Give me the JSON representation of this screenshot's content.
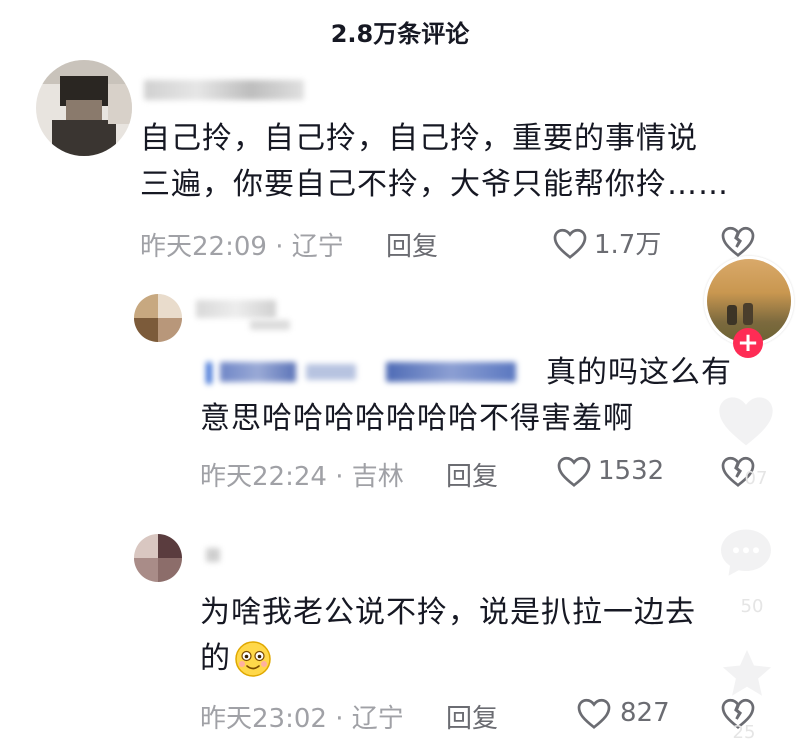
{
  "header": {
    "title": "2.8万条评论"
  },
  "comments": [
    {
      "text_line1": "自己拎，自己拎，自己拎，重要的事情说",
      "text_line2": "三遍，你要自己不拎，大爷只能帮你拎……",
      "time_location": "昨天22:09 · 辽宁",
      "reply_label": "回复",
      "likes": "1.7万"
    },
    {
      "text_line1": "真的吗这么有",
      "text_line2": "意思哈哈哈哈哈哈哈不得害羞啊",
      "time_location": "昨天22:24 · 吉林",
      "reply_label": "回复",
      "likes": "1532"
    },
    {
      "text_line1": "为啥我老公说不拎，说是扒拉一边去",
      "text_line2": "的",
      "time_location": "昨天23:02 · 辽宁",
      "reply_label": "回复",
      "likes": "827"
    }
  ],
  "side_panel": {
    "share_count": "25",
    "comment_count": "50",
    "like_count": "07"
  },
  "icons": {
    "like": "heart-outline-icon",
    "dislike": "broken-heart-icon",
    "emoji": "smile-emoji-icon",
    "follow": "plus-icon",
    "side_like": "heart-icon",
    "side_comment": "comment-bubble-icon",
    "side_favorite": "star-icon"
  },
  "colors": {
    "text_primary": "#161823",
    "text_meta": "#a0a1a6",
    "accent": "#fe2c55"
  }
}
